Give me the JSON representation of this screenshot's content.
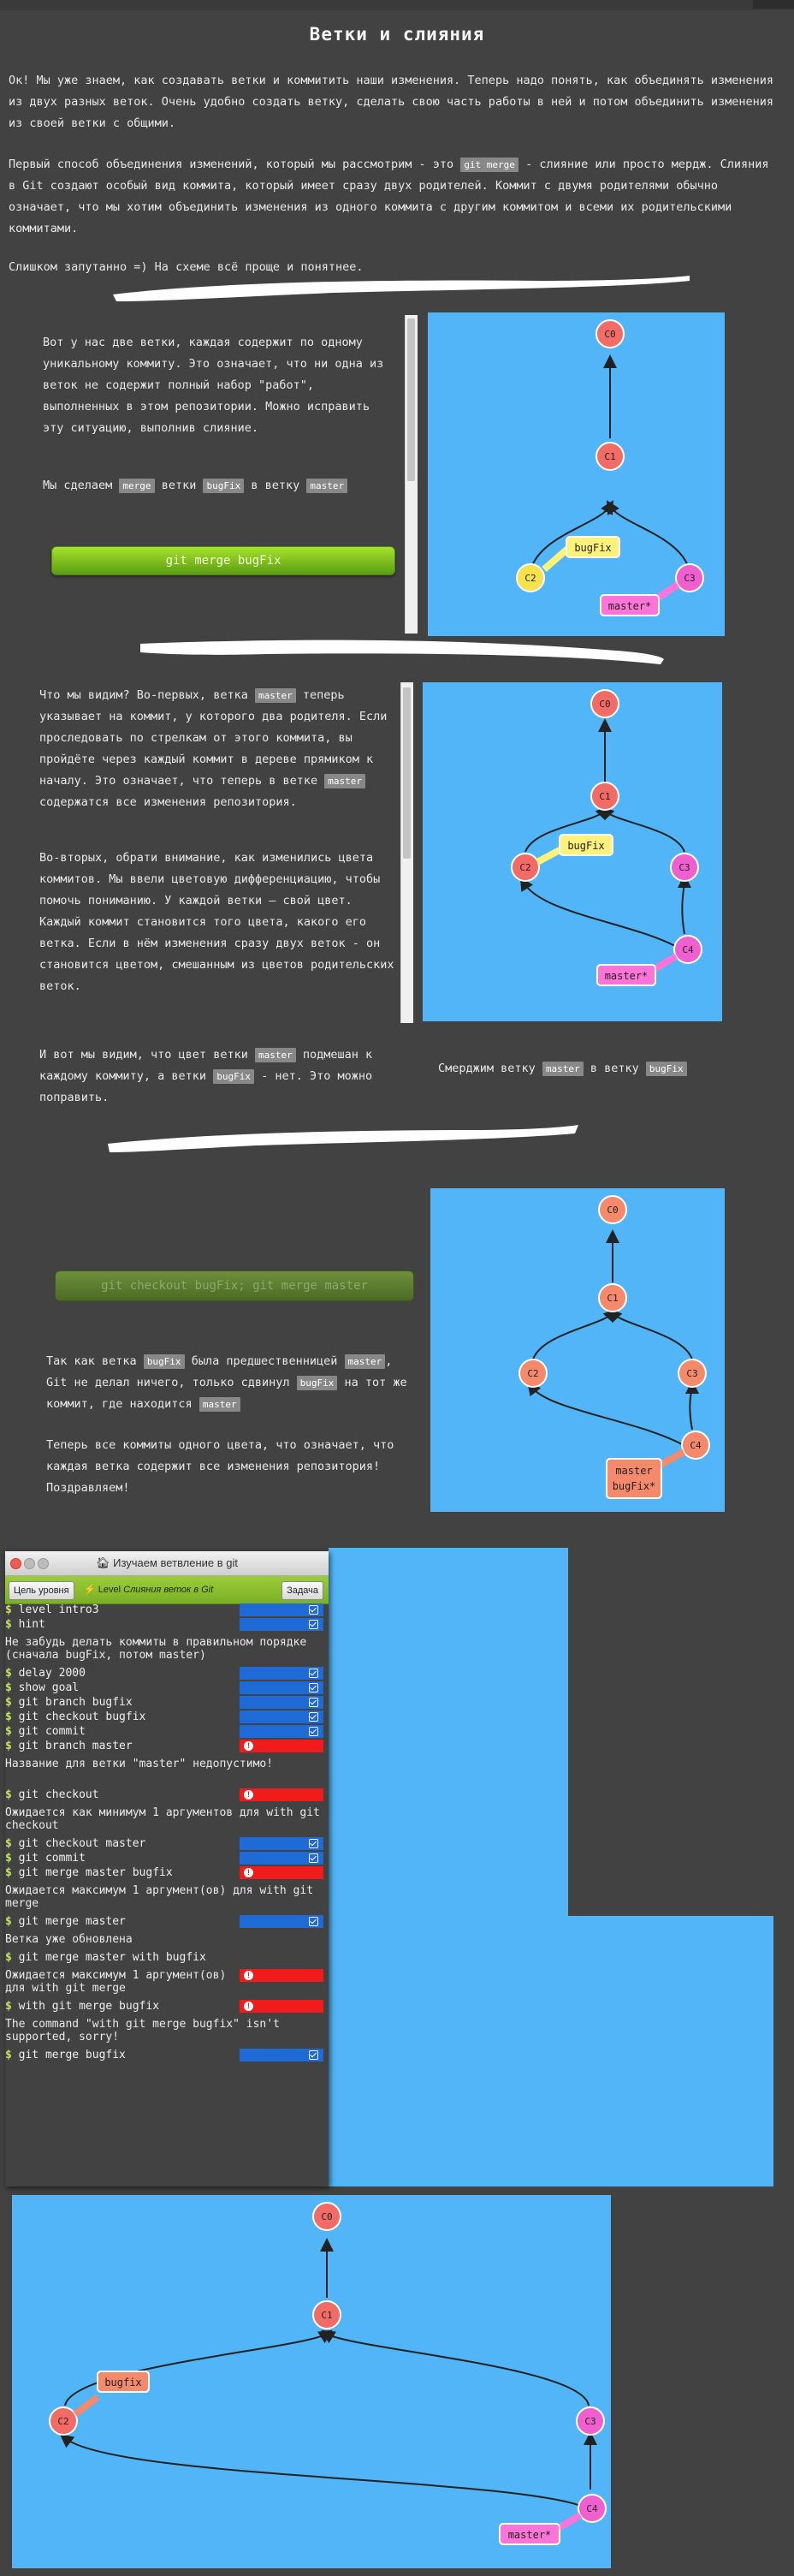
{
  "page": {
    "title": "Ветки и слияния",
    "intro": "Ок! Мы уже знаем, как создавать ветки и коммитить наши изменения. Теперь надо понять, как объединять изменения из двух разных веток. Очень удобно создать ветку, сделать свою часть работы в ней и потом объединить изменения из своей ветки с общими.",
    "p2_a": "Первый способ объединения изменений, который мы рассмотрим - это",
    "p2_code": "git merge",
    "p2_b": "- слияние или просто мердж. Слияния в Git создают особый вид коммита, который имеет сразу двух родителей. Коммит с двумя родителями обычно означает, что мы хотим объединить изменения из одного коммита с другим коммитом и всеми их родительскими коммитами.",
    "p3": "Слишком запутанно =) На схеме всё проще и понятнее."
  },
  "section1": {
    "text": "Вот у нас две ветки, каждая содержит по одному уникальному коммиту. Это означает, что ни одна из веток не содержит полный набор \"работ\", выполненных в этом репозитории. Можно исправить эту ситуацию, выполнив слияние.",
    "merge_a": "Мы сделаем",
    "merge_b": "ветки",
    "merge_c": "в ветку",
    "code_merge": "merge",
    "code_bugfix": "bugFix",
    "code_master": "master",
    "button": "git merge bugFix"
  },
  "section2": {
    "p1_a": "Что мы видим? Во-первых, ветка",
    "p1_code": "master",
    "p1_b": "теперь указывает на коммит, у которого два родителя. Если проследовать по стрелкам от этого коммита, вы пройдёте через каждый коммит в дереве прямиком к началу. Это означает, что теперь в ветке",
    "p1_code2": "master",
    "p1_c": "содержатся все изменения репозитория.",
    "p2": "Во-вторых, обрати внимание, как изменились цвета коммитов. Мы ввели цветовую дифференциацию, чтобы помочь пониманию. У каждой ветки — свой цвет. Каждый коммит становится того цвета, какого его ветка. Если в нём изменения сразу двух веток - он становится цветом, смешанным из цветов родительских веток.",
    "p3_a": "И вот мы видим, что цвет ветки",
    "p3_code": "master",
    "p3_b": "подмешан к каждому коммиту, а ветки",
    "p3_code2": "bugFix",
    "p3_c": "- нет. Это можно поправить.",
    "side_a": "Смерджим ветку",
    "side_code": "master",
    "side_b": "в ветку",
    "side_code2": "bugFix"
  },
  "section3": {
    "button": "git checkout bugFix; git merge master",
    "p1_a": "Так как ветка",
    "p1_code": "bugFix",
    "p1_b": "была предшественницей",
    "p1_code2": "master",
    "p1_c": ", Git не делал ничего, только сдвинул",
    "p1_code3": "bugFix",
    "p1_d": "на тот же коммит, где находится",
    "p1_code4": "master",
    "p2": "Теперь все коммиты одного цвета, что означает, что каждая ветка содержит все изменения репозитория! Поздравляем!"
  },
  "window": {
    "title": "Изучаем ветвление в git",
    "btn_goal": "Цель уровня",
    "level_prefix": "Level",
    "level_name": "Слияния веток в Git",
    "btn_task": "Задача"
  },
  "terminal": [
    {
      "type": "cmd",
      "text": "level intro3",
      "status": "ok"
    },
    {
      "type": "cmd",
      "text": "hint",
      "status": "ok"
    },
    {
      "type": "msg",
      "text": "Не забудь делать коммиты в правильном порядке (сначала bugFix, потом master)"
    },
    {
      "type": "cmd",
      "text": "delay 2000",
      "status": "ok"
    },
    {
      "type": "cmd",
      "text": "show goal",
      "status": "ok"
    },
    {
      "type": "cmd",
      "text": "git branch bugfix",
      "status": "ok"
    },
    {
      "type": "cmd",
      "text": "git checkout bugfix",
      "status": "ok"
    },
    {
      "type": "cmd",
      "text": "git commit",
      "status": "ok"
    },
    {
      "type": "cmd",
      "text": "git branch master",
      "status": "err"
    },
    {
      "type": "msg",
      "text": "Название для ветки \"master\" недопустимо!"
    },
    {
      "type": "cmd",
      "text": "git checkout",
      "status": "err"
    },
    {
      "type": "msg",
      "text": "Ожидается как минимум 1 аргументов для with git checkout"
    },
    {
      "type": "cmd",
      "text": "git checkout master",
      "status": "ok"
    },
    {
      "type": "cmd",
      "text": "git commit",
      "status": "ok"
    },
    {
      "type": "cmd",
      "text": "git merge master bugfix",
      "status": "err"
    },
    {
      "type": "msg",
      "text": "Ожидается максимум 1 аргумент(ов) для with git merge"
    },
    {
      "type": "cmd",
      "text": "git merge master",
      "status": "ok"
    },
    {
      "type": "msg",
      "text": "Ветка уже обновлена"
    },
    {
      "type": "cmd",
      "text": "git merge master with bugfix",
      "status": "none"
    },
    {
      "type": "msg_err",
      "text": "Ожидается максимум 1 аргумент(ов) для with git merge"
    },
    {
      "type": "cmd",
      "text": "with git merge bugfix",
      "status": "err"
    },
    {
      "type": "msg",
      "text": "The command \"with git merge bugfix\" isn't supported, sorry!"
    },
    {
      "type": "cmd",
      "text": "git merge bugfix",
      "status": "ok"
    }
  ],
  "graphs": {
    "g1": {
      "c0": "C0",
      "c1": "C1",
      "c2": "C2",
      "c3": "C3",
      "b1": "bugFix",
      "b2": "master*"
    },
    "g2": {
      "c0": "C0",
      "c1": "C1",
      "c2": "C2",
      "c3": "C3",
      "c4": "C4",
      "b1": "bugFix",
      "b2": "master*"
    },
    "g3": {
      "c0": "C0",
      "c1": "C1",
      "c2": "C2",
      "c3": "C3",
      "c4": "C4",
      "b1": "master",
      "b2": "bugFix*"
    },
    "g4": {
      "c0": "C0",
      "c1": "C1",
      "c2": "C2",
      "c3": "C3",
      "c4": "C4",
      "b1": "bugfix",
      "b2": "master*"
    }
  },
  "colors": {
    "bg": "#424242",
    "panel": "#52b5f7",
    "commit_red": "#f26b67",
    "commit_yellow": "#f7e24e",
    "commit_pink": "#f05fcf",
    "commit_orange": "#f48a6b",
    "branch_yellow": "#fff27a",
    "branch_pink": "#ff74d8"
  }
}
